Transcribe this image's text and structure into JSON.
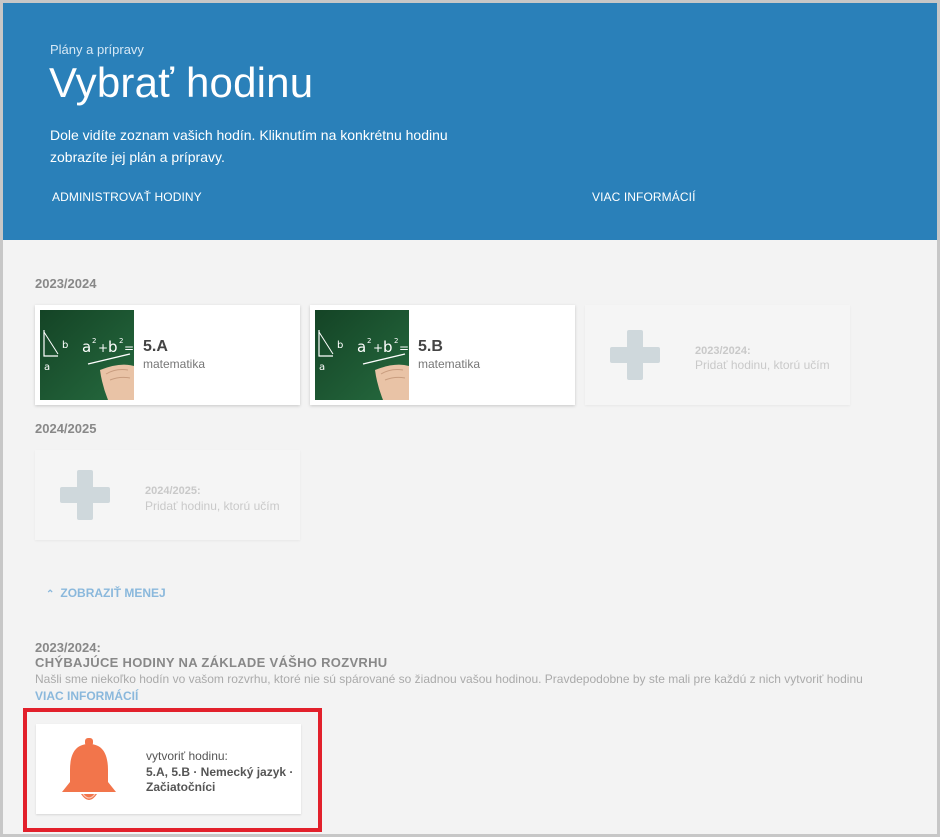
{
  "header": {
    "breadcrumb": "Plány a prípravy",
    "title": "Vybrať hodinu",
    "description": "Dole vidíte zoznam vašich hodín. Kliknutím na konkrétnu hodinu zobrazíte jej plán a prípravy.",
    "admin_link": "ADMINISTROVAŤ HODINY",
    "info_link": "VIAC INFORMÁCIÍ"
  },
  "years": [
    {
      "label": "2023/2024",
      "classes": [
        {
          "name": "5.A",
          "subject": "matematika"
        },
        {
          "name": "5.B",
          "subject": "matematika"
        }
      ],
      "add": {
        "year": "2023/2024:",
        "text": "Pridať hodinu, ktorú učím"
      }
    },
    {
      "label": "2024/2025",
      "add": {
        "year": "2024/2025:",
        "text": "Pridať hodinu, ktorú učím"
      }
    }
  ],
  "show_less": "ZOBRAZIŤ MENEJ",
  "missing": {
    "year": "2023/2024:",
    "title": "CHÝBAJÚCE HODINY NA ZÁKLADE VÁŠHO ROZVRHU",
    "description": "Našli sme niekoľko hodín vo vašom rozvrhu, ktoré nie sú spárované so žiadnou vašou hodinou. Pravdepodobne by ste mali pre každú z nich vytvoriť hodinu",
    "more_link": "VIAC INFORMÁCIÍ",
    "card": {
      "label": "vytvoriť hodinu:",
      "value": "5.A, 5.B · Nemecký jazyk · Začiatočníci"
    }
  },
  "colors": {
    "header_bg": "#2a80b9",
    "accent_link": "#8ab8dc",
    "bell": "#f2754b",
    "highlight": "#e2202b"
  }
}
